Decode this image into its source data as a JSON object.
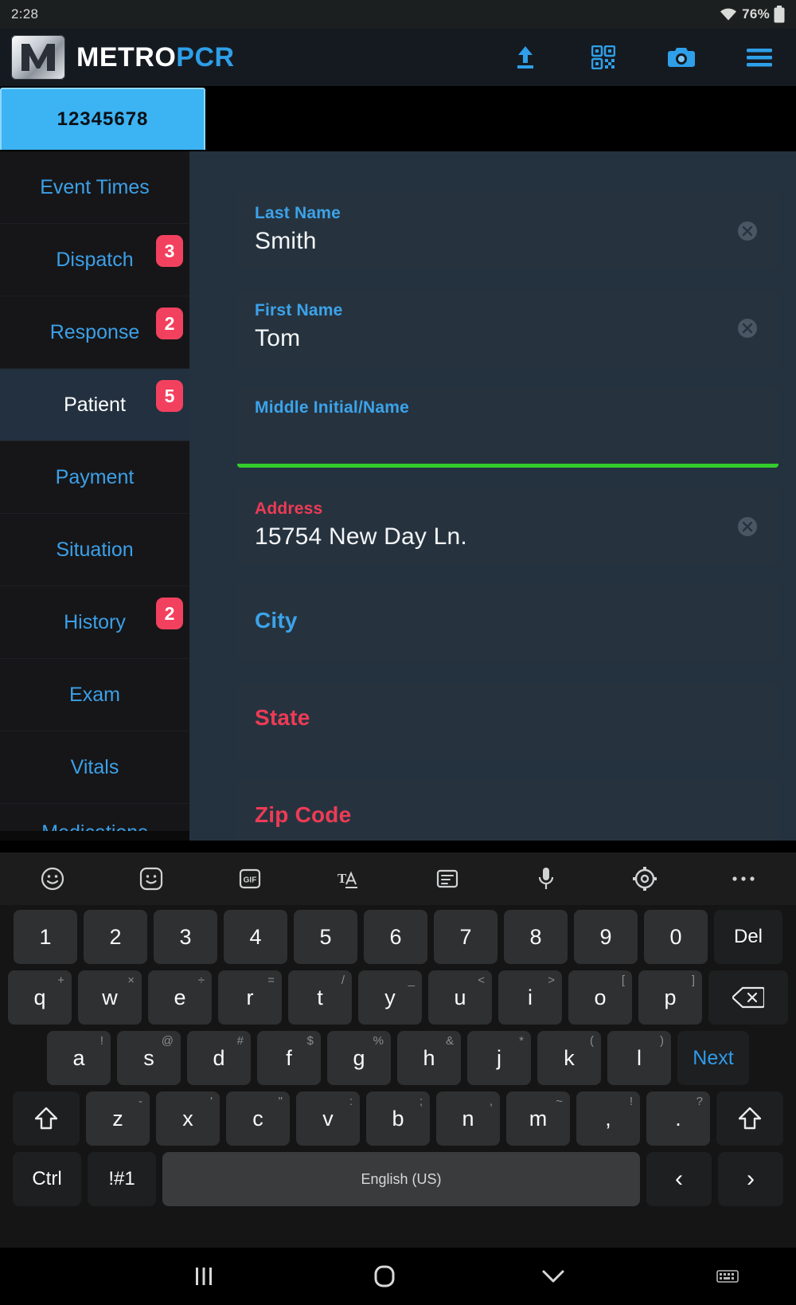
{
  "statusbar": {
    "time": "2:28",
    "battery_pct": "76%",
    "wifi_icon": "wifi-icon",
    "battery_icon": "battery-icon"
  },
  "appbar": {
    "brand_first": "METRO",
    "brand_second": "PCR",
    "logo_icon": "metro-m-logo-icon",
    "actions": [
      {
        "name": "upload-icon",
        "label": "Upload"
      },
      {
        "name": "qr-scan-icon",
        "label": "Scan QR"
      },
      {
        "name": "camera-icon",
        "label": "Camera"
      },
      {
        "name": "hamburger-menu-icon",
        "label": "Menu"
      }
    ]
  },
  "incident_tab": {
    "label": "12345678"
  },
  "sidebar": {
    "items": [
      {
        "label": "Event Times",
        "badge": "",
        "active": false
      },
      {
        "label": "Dispatch",
        "badge": "3",
        "active": false
      },
      {
        "label": "Response",
        "badge": "2",
        "active": false
      },
      {
        "label": "Patient",
        "badge": "5",
        "active": true
      },
      {
        "label": "Payment",
        "badge": "",
        "active": false
      },
      {
        "label": "Situation",
        "badge": "",
        "active": false
      },
      {
        "label": "History",
        "badge": "2",
        "active": false
      },
      {
        "label": "Exam",
        "badge": "",
        "active": false
      },
      {
        "label": "Vitals",
        "badge": "",
        "active": false
      },
      {
        "label": "Medications",
        "badge": "",
        "active": false
      }
    ]
  },
  "form": {
    "fields": [
      {
        "label": "Last Name",
        "value": "Smith",
        "required": false,
        "focused": false,
        "clearable": true,
        "empty_big": false
      },
      {
        "label": "First Name",
        "value": "Tom",
        "required": false,
        "focused": false,
        "clearable": true,
        "empty_big": false
      },
      {
        "label": "Middle Initial/Name",
        "value": "",
        "required": false,
        "focused": true,
        "clearable": false,
        "empty_big": false
      },
      {
        "label": "Address",
        "value": "15754 New Day Ln.",
        "required": true,
        "focused": false,
        "clearable": true,
        "empty_big": false
      },
      {
        "label": "City",
        "value": "",
        "required": false,
        "focused": false,
        "clearable": false,
        "empty_big": true
      },
      {
        "label": "State",
        "value": "",
        "required": true,
        "focused": false,
        "clearable": false,
        "empty_big": true
      },
      {
        "label": "Zip Code",
        "value": "",
        "required": true,
        "focused": false,
        "clearable": false,
        "empty_big": true
      }
    ],
    "focus_underline_color": "#34cc2c",
    "label_color": "#3ca3ea",
    "required_color": "#ee3b55"
  },
  "keyboard": {
    "toolbar_icons": [
      "emoji-icon",
      "sticker-icon",
      "gif-icon",
      "text-style-icon",
      "clipboard-icon",
      "microphone-icon",
      "gear-icon",
      "more-options-icon"
    ],
    "row_numbers": [
      {
        "main": "1",
        "sup": ""
      },
      {
        "main": "2",
        "sup": ""
      },
      {
        "main": "3",
        "sup": ""
      },
      {
        "main": "4",
        "sup": ""
      },
      {
        "main": "5",
        "sup": ""
      },
      {
        "main": "6",
        "sup": ""
      },
      {
        "main": "7",
        "sup": ""
      },
      {
        "main": "8",
        "sup": ""
      },
      {
        "main": "9",
        "sup": ""
      },
      {
        "main": "0",
        "sup": ""
      }
    ],
    "del_label": "Del",
    "row_q": [
      {
        "main": "q",
        "sup": "+"
      },
      {
        "main": "w",
        "sup": "×"
      },
      {
        "main": "e",
        "sup": "÷"
      },
      {
        "main": "r",
        "sup": "="
      },
      {
        "main": "t",
        "sup": "/"
      },
      {
        "main": "y",
        "sup": "_"
      },
      {
        "main": "u",
        "sup": "<"
      },
      {
        "main": "i",
        "sup": ">"
      },
      {
        "main": "o",
        "sup": "["
      },
      {
        "main": "p",
        "sup": "]"
      }
    ],
    "backspace_icon": "backspace-icon",
    "row_a": [
      {
        "main": "a",
        "sup": "!"
      },
      {
        "main": "s",
        "sup": "@"
      },
      {
        "main": "d",
        "sup": "#"
      },
      {
        "main": "f",
        "sup": "$"
      },
      {
        "main": "g",
        "sup": "%"
      },
      {
        "main": "h",
        "sup": "&"
      },
      {
        "main": "j",
        "sup": "*"
      },
      {
        "main": "k",
        "sup": "("
      },
      {
        "main": "l",
        "sup": ")"
      }
    ],
    "next_label": "Next",
    "row_z": [
      {
        "main": "z",
        "sup": "-"
      },
      {
        "main": "x",
        "sup": "'"
      },
      {
        "main": "c",
        "sup": "\""
      },
      {
        "main": "v",
        "sup": ":"
      },
      {
        "main": "b",
        "sup": ";"
      },
      {
        "main": "n",
        "sup": ","
      },
      {
        "main": "m",
        "sup": "~"
      },
      {
        "main": ",",
        "sup": "!"
      },
      {
        "main": ".",
        "sup": "?"
      }
    ],
    "shift_icon": "shift-icon",
    "ctrl_label": "Ctrl",
    "symbols_label": "!#1",
    "space_label": "English (US)",
    "arrow_left": "‹",
    "arrow_right": "›"
  },
  "navbar": {
    "recent_icon": "recent-apps-icon",
    "home_icon": "home-icon",
    "back_icon": "hide-keyboard-chevron-icon",
    "keyboard_icon": "keyboard-switch-icon"
  },
  "colors": {
    "accent_blue": "#3ca0e8",
    "badge_red": "#f2415f",
    "panel_bg": "#24313f",
    "field_bg": "#26333f",
    "focus_green": "#34cc2c"
  }
}
